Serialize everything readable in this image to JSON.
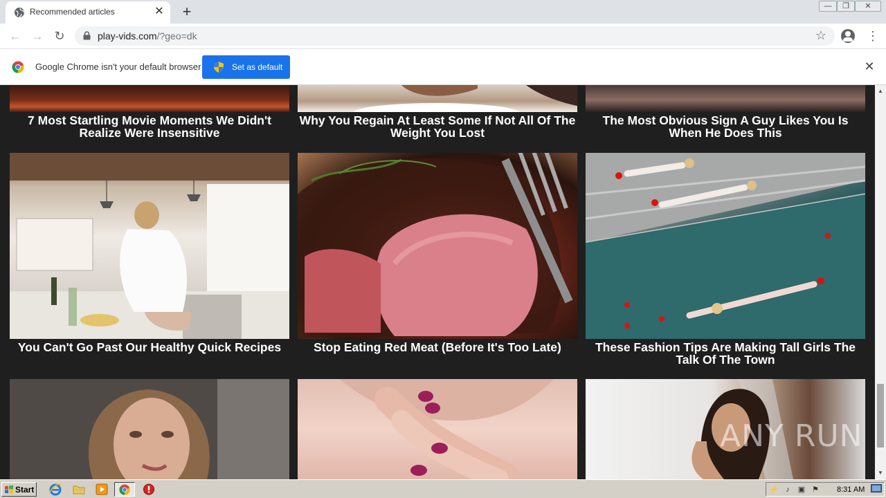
{
  "browser": {
    "tab": {
      "title": "Recommended articles",
      "close_glyph": "✕"
    },
    "new_tab_glyph": "+",
    "window_controls": {
      "minimize": "—",
      "restore": "❐",
      "close": "✕"
    },
    "nav": {
      "back": "←",
      "forward": "→",
      "reload": "↻"
    },
    "omnibox": {
      "host": "play-vids.com",
      "path": "/?geo=dk"
    },
    "bookmark_glyph": "☆",
    "menu_glyph": "⋮"
  },
  "infobar": {
    "message": "Google Chrome isn't your default browser",
    "button_label": "Set as default",
    "close_glyph": "✕"
  },
  "articles": {
    "row1": [
      {
        "title": "7 Most Startling Movie Moments We Didn't Realize Were Insensitive",
        "image": "movie-scene"
      },
      {
        "title": "Why You Regain At Least Some If Not All Of The Weight You Lost",
        "image": "hands-plate"
      },
      {
        "title": "The Most Obvious Sign A Guy Likes You Is When He Does This",
        "image": "couple"
      }
    ],
    "row2": [
      {
        "title": "You Can't Go Past Our Healthy Quick Recipes",
        "image": "woman-kitchen"
      },
      {
        "title": "Stop Eating Red Meat (Before It's Too Late)",
        "image": "steak-fork"
      },
      {
        "title": "These Fashion Tips Are Making Tall Girls The Talk Of The Town",
        "image": "pool-fashion"
      }
    ],
    "row3": [
      {
        "title": "",
        "image": "woman-portrait"
      },
      {
        "title": "",
        "image": "hands-nails"
      },
      {
        "title": "",
        "image": "woman-selfie"
      }
    ]
  },
  "watermark": "ANY RUN",
  "scrollbar": {
    "up": "▲",
    "down": "▼"
  },
  "taskbar": {
    "start_label": "Start",
    "icons": [
      "ie-icon",
      "folder-icon",
      "media-player-icon",
      "chrome-icon",
      "stop-icon"
    ],
    "tray_icons": [
      "network-icon",
      "volume-icon",
      "monitor-icon",
      "flag-icon"
    ],
    "time": "8:31 AM"
  }
}
